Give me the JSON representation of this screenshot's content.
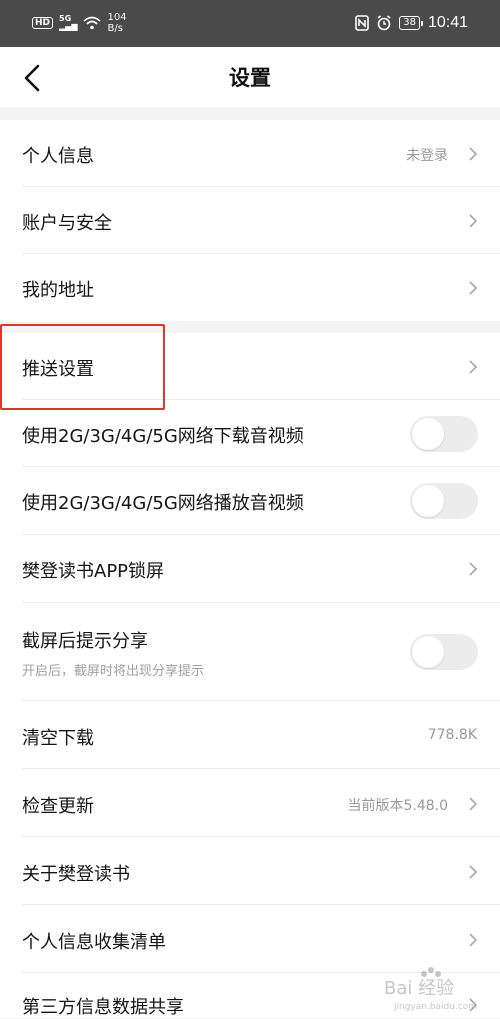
{
  "status_bar": {
    "hd": "HD",
    "signal": "5G",
    "speed_value": "104",
    "speed_unit": "B/s",
    "battery": "38",
    "time": "10:41"
  },
  "nav": {
    "title": "设置"
  },
  "rows": [
    {
      "label": "个人信息",
      "value": "未登录",
      "control": "chevron"
    },
    {
      "label": "账户与安全",
      "control": "chevron"
    },
    {
      "label": "我的地址",
      "control": "chevron"
    },
    {
      "label": "推送设置",
      "control": "chevron"
    },
    {
      "label": "使用2G/3G/4G/5G网络下载音视频",
      "control": "toggle",
      "on": false
    },
    {
      "label": "使用2G/3G/4G/5G网络播放音视频",
      "control": "toggle",
      "on": false
    },
    {
      "label": "樊登读书APP锁屏",
      "control": "chevron"
    },
    {
      "label": "截屏后提示分享",
      "sub": "开启后，截屏时将出现分享提示",
      "control": "toggle",
      "on": false
    },
    {
      "label": "清空下载",
      "value": "778.8K",
      "control": "none"
    },
    {
      "label": "检查更新",
      "value": "当前版本5.48.0",
      "control": "chevron"
    },
    {
      "label": "关于樊登读书",
      "control": "chevron"
    },
    {
      "label": "个人信息收集清单",
      "control": "chevron"
    },
    {
      "label": "第三方信息数据共享",
      "control": "chevron"
    }
  ],
  "watermark": {
    "brand": "Bai 经验",
    "url": "jingyan.baidu.com"
  },
  "colors": {
    "highlight": "#e0352f",
    "status_bar_bg": "#4a4a4a"
  }
}
